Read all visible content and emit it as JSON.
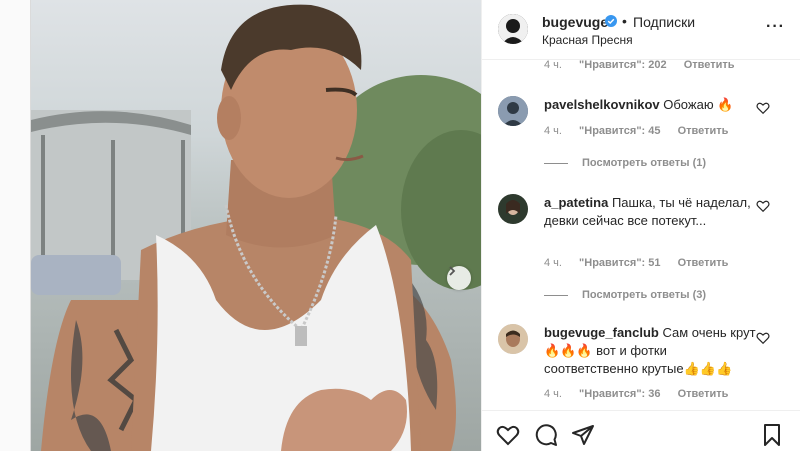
{
  "header": {
    "username": "bugevuge",
    "follow_label": "Подписки",
    "location": "Красная Пресня",
    "more_icon": "more-horizontal-icon"
  },
  "comments": [
    {
      "username": "",
      "text": "",
      "time": "4 ч.",
      "likes": "\"Нравится\": 202",
      "reply": "Ответить"
    },
    {
      "username": "pavelshelkovnikov",
      "text": "Обожаю",
      "emoji": "🔥",
      "time": "4 ч.",
      "likes": "\"Нравится\": 45",
      "reply": "Ответить",
      "view_replies": "Посмотреть ответы (1)"
    },
    {
      "username": "a_patetina",
      "text": "Пашка, ты чё наделал, девки сейчас все потекут...",
      "time": "4 ч.",
      "likes": "\"Нравится\": 51",
      "reply": "Ответить",
      "view_replies": "Посмотреть ответы (3)"
    },
    {
      "username": "bugevuge_fanclub",
      "text_part1": "Сам очень крут",
      "emoji1": "🔥🔥🔥",
      "text_part2": " вот и фотки соответственно крутые",
      "emoji2": "👍👍👍",
      "time": "4 ч.",
      "likes": "\"Нравится\": 36",
      "reply": "Ответить"
    }
  ],
  "actions": {
    "like_icon": "heart-icon",
    "comment_icon": "comment-icon",
    "share_icon": "share-icon",
    "save_icon": "bookmark-icon"
  },
  "colors": {
    "verified": "#3897f0",
    "text": "#262626",
    "muted": "#8e8e8e",
    "border": "#dbdbdb"
  }
}
